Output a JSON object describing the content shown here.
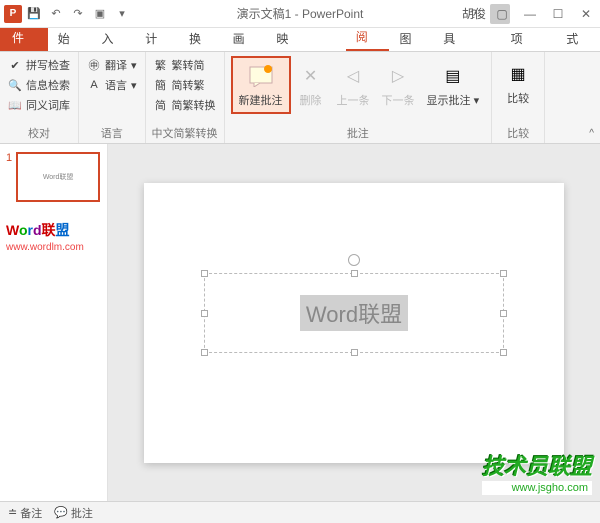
{
  "titlebar": {
    "title": "演示文稿1 - PowerPoint",
    "user": "胡俊"
  },
  "tabs": {
    "file": "文件",
    "items": [
      "开始",
      "插入",
      "设计",
      "切换",
      "动画",
      "幻灯片放映",
      "审阅",
      "视图",
      "开发工具",
      "加载项",
      "格式"
    ],
    "active": "审阅"
  },
  "ribbon": {
    "proofing": {
      "spell": "拼写检查",
      "research": "信息检索",
      "thesaurus": "同义词库",
      "label": "校对"
    },
    "language": {
      "translate": "翻译",
      "lang": "语言",
      "label": "语言"
    },
    "chinese": {
      "t2s": "繁转简",
      "s2t": "简转繁",
      "convert": "简繁转换",
      "label": "中文简繁转换"
    },
    "comments": {
      "new": "新建批注",
      "del": "删除",
      "prev": "上一条",
      "next": "下一条",
      "show": "显示批注",
      "label": "批注"
    },
    "compare": {
      "compare": "比较",
      "label": "比较"
    }
  },
  "thumb": {
    "num": "1",
    "preview": "Word联盟"
  },
  "watermark": {
    "brand_chars": [
      "W",
      "o",
      "r",
      "d",
      "联",
      "盟"
    ],
    "url": "www.wordlm.com"
  },
  "slide": {
    "text": "Word联盟"
  },
  "statusbar": {
    "notes": "备注",
    "comments": "批注"
  },
  "bottom_wm": {
    "line1": "技术员联盟",
    "line2": "www.jsgho.com"
  }
}
